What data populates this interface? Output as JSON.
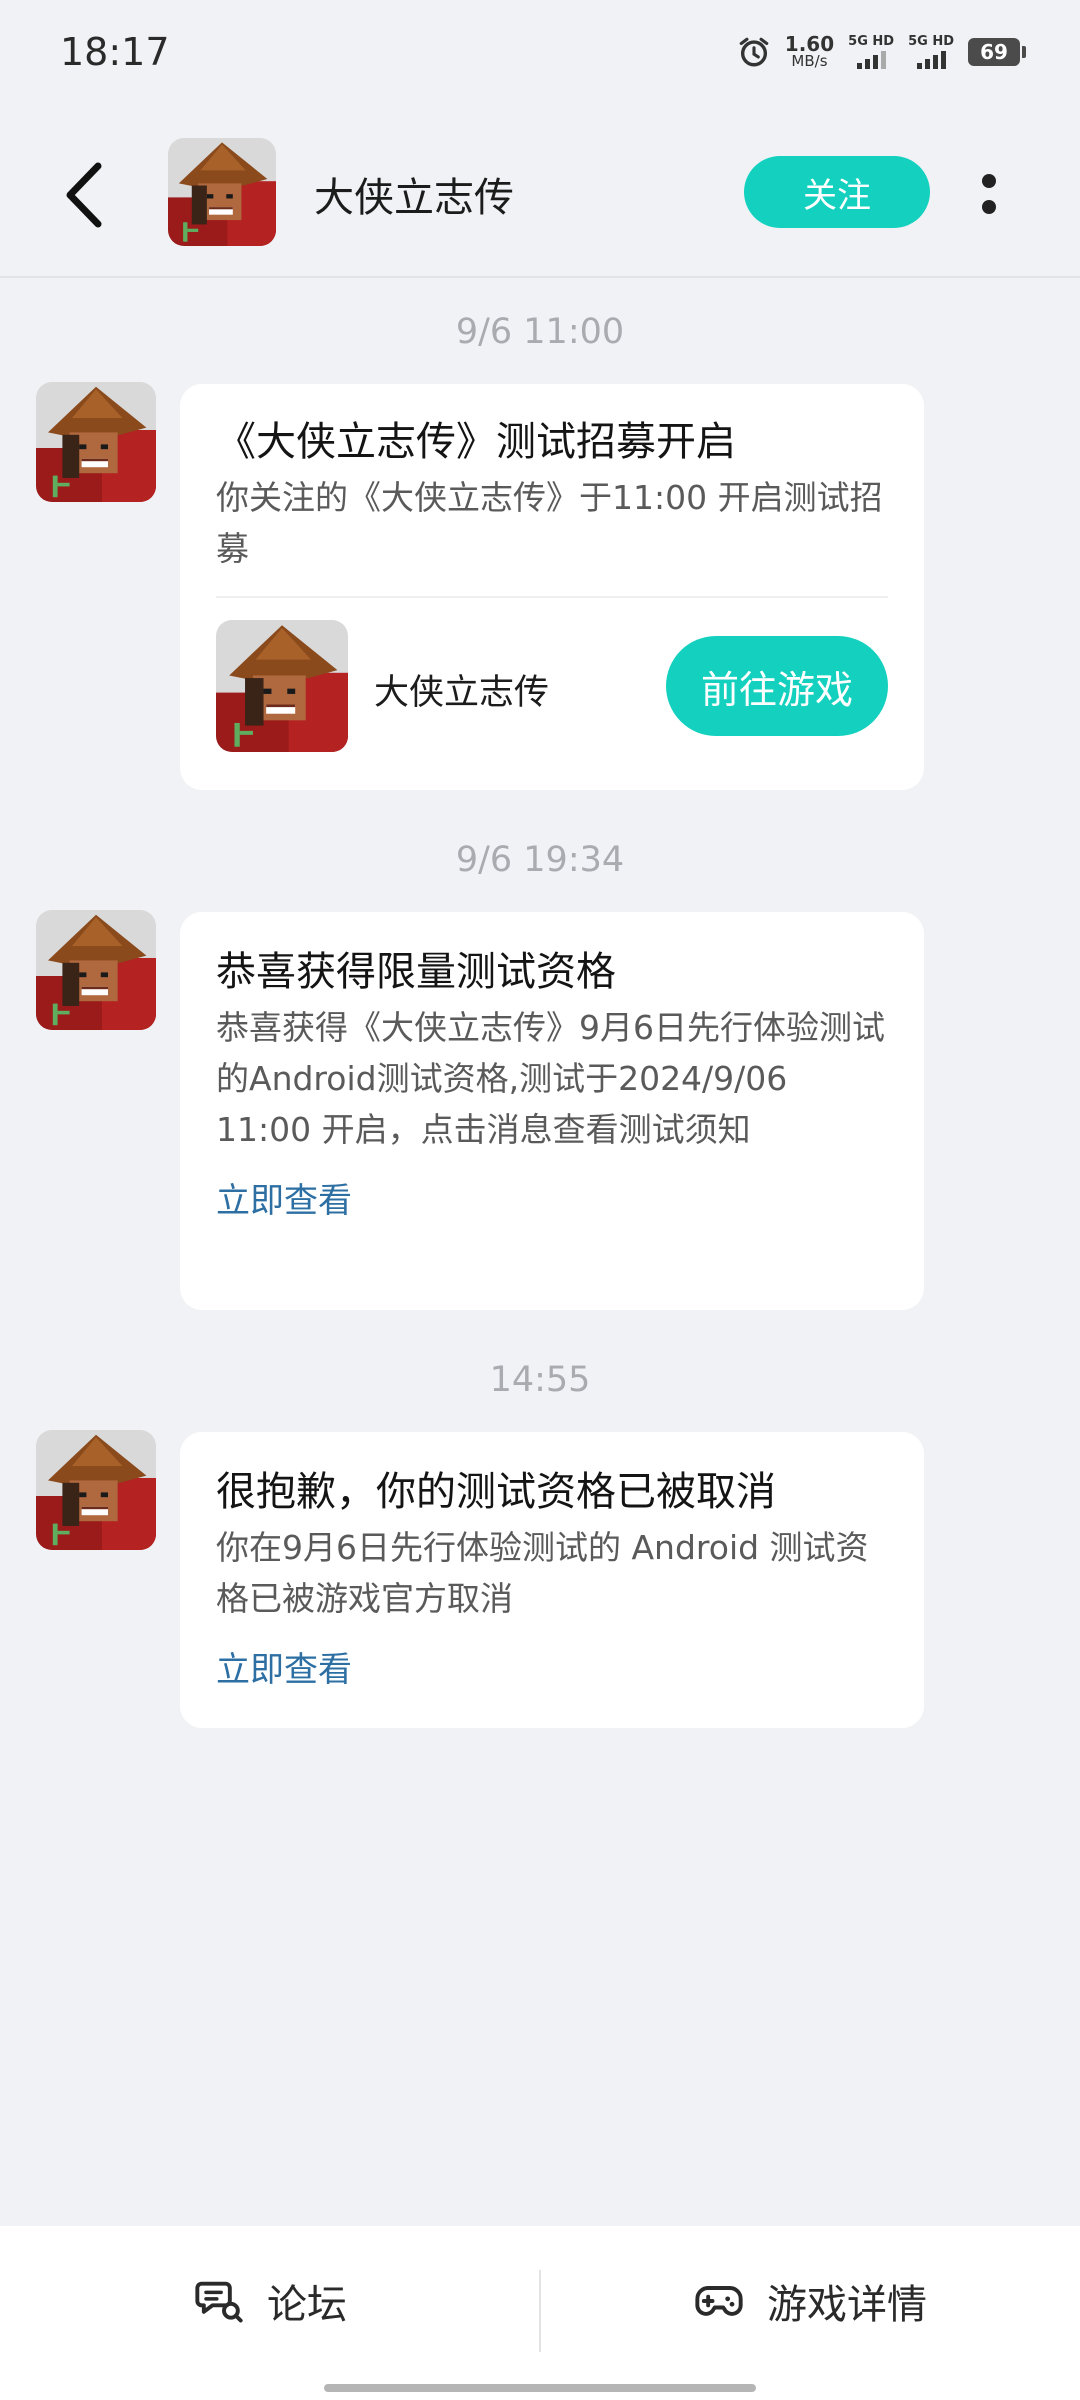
{
  "status_bar": {
    "time": "18:17",
    "net_speed_value": "1.60",
    "net_speed_unit": "MB/s",
    "sim1_label": "5G HD",
    "sim2_label": "5G HD",
    "battery": "69"
  },
  "header": {
    "title": "大侠立志传",
    "follow_label": "关注"
  },
  "messages": [
    {
      "time": "9/6  11:00",
      "title": "《大侠立志传》测试招募开启",
      "body": "你关注的《大侠立志传》于11:00 开启测试招募",
      "game_name": "大侠立志传",
      "action_label": "前往游戏"
    },
    {
      "time": "9/6  19:34",
      "title": "恭喜获得限量测试资格",
      "body": "恭喜获得《大侠立志传》9月6日先行体验测试的Android测试资格,测试于2024/9/06 11:00 开启，点击消息查看测试须知",
      "link_label": "立即查看"
    },
    {
      "time": "14:55",
      "title": "很抱歉，你的测试资格已被取消",
      "body": "你在9月6日先行体验测试的 Android 测试资格已被游戏官方取消",
      "link_label": "立即查看"
    }
  ],
  "bottom_tabs": {
    "forum_label": "论坛",
    "details_label": "游戏详情"
  },
  "colors": {
    "accent": "#14d1bf",
    "link": "#2d6fa3",
    "background": "#f1f2f5"
  }
}
